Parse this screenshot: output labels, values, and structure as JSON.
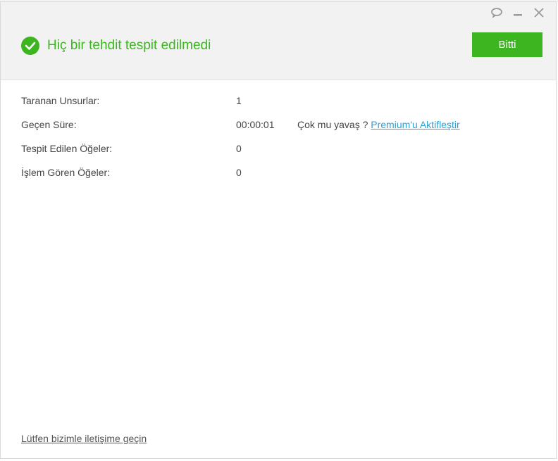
{
  "header": {
    "status_text": "Hiç bir tehdit tespit edilmedi",
    "done_label": "Bitti",
    "accent_color": "#3cb521"
  },
  "window_controls": {
    "chat_icon": "chat-bubble-icon",
    "minimize_icon": "minimize-icon",
    "close_icon": "close-icon"
  },
  "stats": [
    {
      "label": "Taranan Unsurlar:",
      "value": "1"
    },
    {
      "label": "Geçen Süre:",
      "value": "00:00:01"
    },
    {
      "label": "Tespit Edilen Öğeler:",
      "value": "0"
    },
    {
      "label": "İşlem Gören Öğeler:",
      "value": "0"
    }
  ],
  "upsell": {
    "prompt": "Çok mu yavaş ?",
    "link": "Premium'u Aktifleştir",
    "link_color": "#2aa1d8"
  },
  "footer": {
    "contact_link": "Lütfen bizimle iletişime geçin"
  }
}
